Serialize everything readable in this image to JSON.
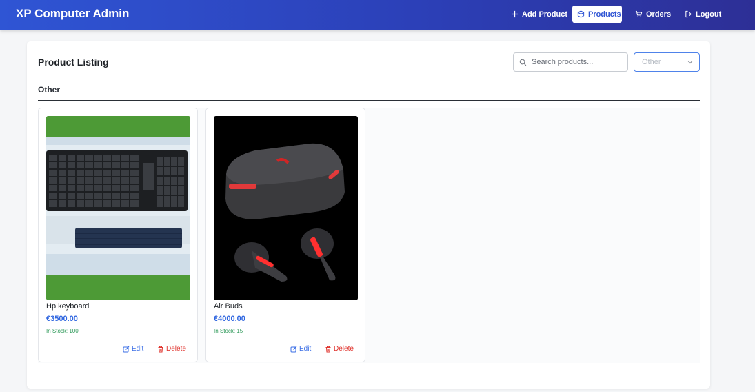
{
  "app": {
    "title": "XP Computer Admin"
  },
  "nav": {
    "add_product": "Add Product",
    "products": "Products",
    "orders": "Orders",
    "logout": "Logout"
  },
  "listing": {
    "title": "Product Listing",
    "search_placeholder": "Search products...",
    "category_filter": "Other",
    "section_title": "Other"
  },
  "products": [
    {
      "name": "Hp keyboard",
      "price": "€3500.00",
      "stock": "In Stock: 100",
      "edit": "Edit",
      "delete": "Delete"
    },
    {
      "name": "Air Buds",
      "price": "€4000.00",
      "stock": "In Stock: 15",
      "edit": "Edit",
      "delete": "Delete"
    }
  ],
  "colors": {
    "header_start": "#2f55d4",
    "header_end": "#2d2f96",
    "accent": "#2f66e0",
    "stock_green": "#2f9a5a",
    "delete_red": "#e0352f"
  }
}
